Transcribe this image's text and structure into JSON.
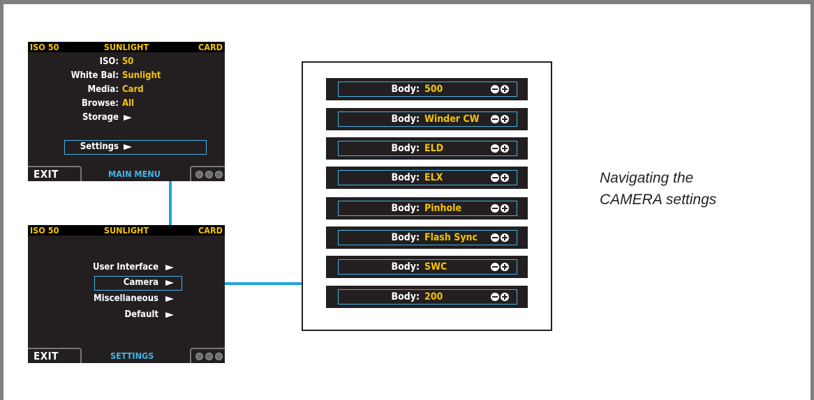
{
  "main_menu": {
    "status": {
      "iso": "ISO 50",
      "white_balance": "SUNLIGHT",
      "media": "CARD"
    },
    "rows": [
      {
        "label": "ISO:",
        "value": "50"
      },
      {
        "label": "White Bal:",
        "value": "Sunlight"
      },
      {
        "label": "Media:",
        "value": "Card"
      },
      {
        "label": "Browse:",
        "value": "All"
      }
    ],
    "submenus": [
      {
        "label": "Storage"
      },
      {
        "label": "Settings",
        "selected": true
      }
    ],
    "exit_label": "EXIT",
    "menu_name": "MAIN MENU"
  },
  "settings_menu": {
    "status": {
      "iso": "ISO 50",
      "white_balance": "SUNLIGHT",
      "media": "CARD"
    },
    "items": [
      {
        "label": "User Interface"
      },
      {
        "label": "Camera",
        "selected": true
      },
      {
        "label": "Miscellaneous"
      },
      {
        "label": "Default"
      }
    ],
    "exit_label": "EXIT",
    "menu_name": "SETTINGS"
  },
  "camera_body": {
    "label": "Body:",
    "options": [
      "500",
      "Winder CW",
      "ELD",
      "ELX",
      "Pinhole",
      "Flash Sync",
      "SWC",
      "200"
    ],
    "controls": [
      "minus-icon",
      "plus-icon"
    ]
  },
  "caption": {
    "line1": "Navigating the",
    "line2": "CAMERA settings"
  },
  "colors": {
    "accent_blue": "#43b3e6",
    "connector": "#1fa3e0",
    "value_yellow": "#f5c400",
    "screen_bg": "#231f20"
  }
}
